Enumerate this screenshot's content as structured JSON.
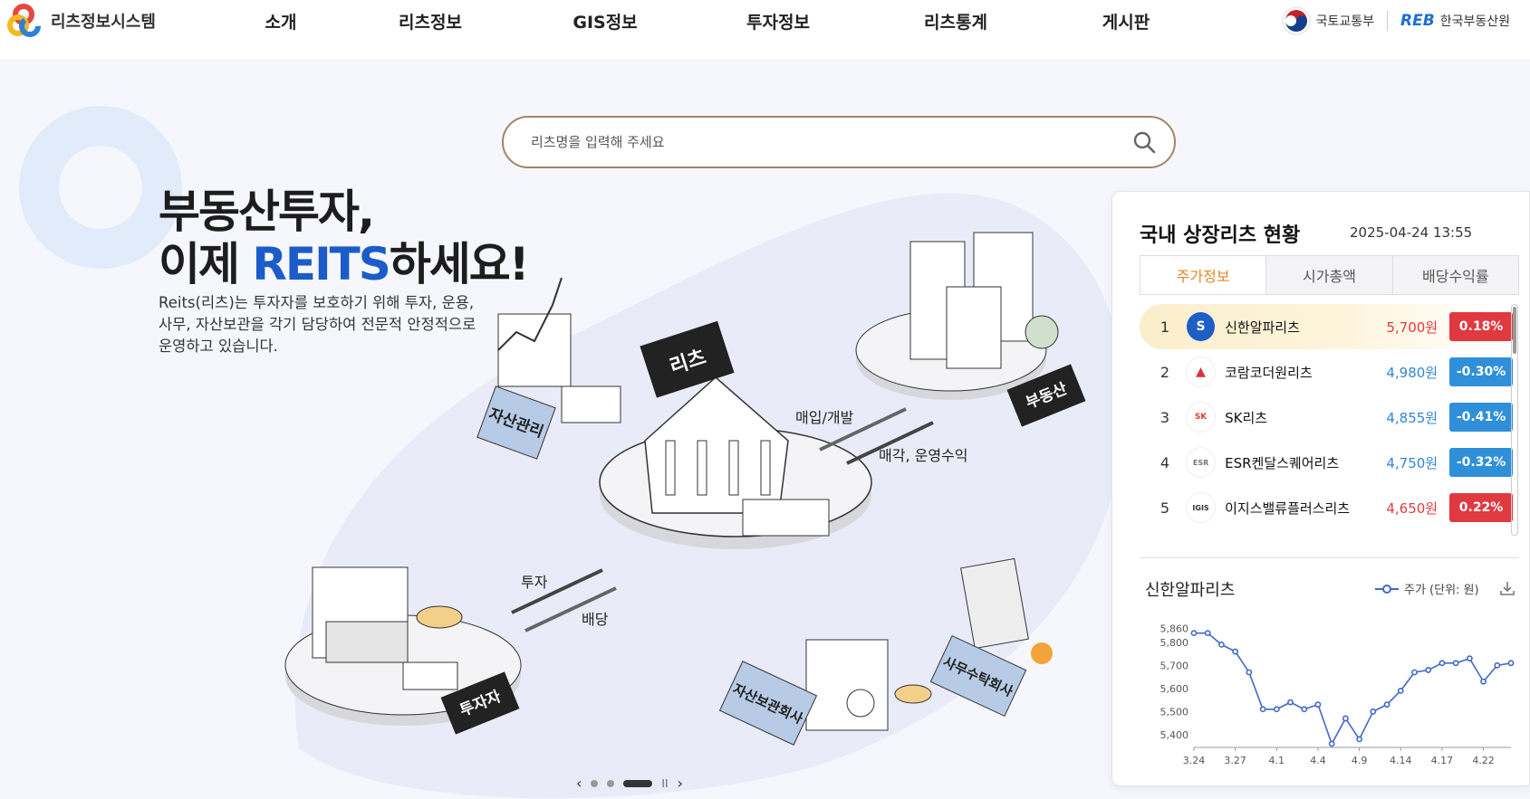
{
  "header": {
    "site_name": "리츠정보시스템",
    "nav": [
      "소개",
      "리츠정보",
      "GIS정보",
      "투자정보",
      "리츠통계",
      "게시판"
    ],
    "partner_molit": "국토교통부",
    "partner_reb_mark": "REB",
    "partner_reb": "한국부동산원"
  },
  "search": {
    "placeholder": "리츠명을 입력해 주세요"
  },
  "hero": {
    "title_line1": "부동산투자,",
    "title_line2_pre": "이제 ",
    "title_line2_accent": "REITS",
    "title_line2_post": "하세요!",
    "description": "Reits(리츠)는 투자자를 보호하기 위해 투자, 운용, 사무, 자산보관을 각기 담당하여 전문적 안정적으로 운영하고 있습니다."
  },
  "illustration": {
    "labels": {
      "center": "리츠",
      "asset_mgmt": "자산관리",
      "real_estate": "부동산",
      "investor": "투자자",
      "custodian": "자산보관회사",
      "admin": "사무수탁회사",
      "buy": "매입/개발",
      "sell": "매각, 운영수익",
      "invest": "투자",
      "dividend": "배당"
    }
  },
  "slider": {
    "prev": "‹",
    "next": "›",
    "pause": "II"
  },
  "panel": {
    "title": "국내 상장리츠 현황",
    "timestamp": "2025-04-24 13:55",
    "tabs": [
      "주가정보",
      "시가총액",
      "배당수익률"
    ],
    "rows": [
      {
        "rank": "1",
        "logo": "S",
        "name": "신한알파리츠",
        "price": "5,700원",
        "change": "0.18%",
        "dir": "up"
      },
      {
        "rank": "2",
        "logo": "▲",
        "name": "코람코더원리츠",
        "price": "4,980원",
        "change": "-0.30%",
        "dir": "down"
      },
      {
        "rank": "3",
        "logo": "SK",
        "name": "SK리츠",
        "price": "4,855원",
        "change": "-0.41%",
        "dir": "down"
      },
      {
        "rank": "4",
        "logo": "ESR",
        "name": "ESR켄달스퀘어리츠",
        "price": "4,750원",
        "change": "-0.32%",
        "dir": "down"
      },
      {
        "rank": "5",
        "logo": "IGIS",
        "name": "이지스밸류플러스리츠",
        "price": "4,650원",
        "change": "0.22%",
        "dir": "up"
      }
    ],
    "chart_title": "신한알파리츠",
    "legend": "주가 (단위: 원)"
  },
  "colors": {
    "accent_blue": "#1c5cc8",
    "up": "#e0393f",
    "down": "#2f8fd9",
    "tab_active": "#e0862a",
    "search_border": "#a08566"
  },
  "chart_data": {
    "type": "line",
    "series": [
      {
        "name": "주가 (단위: 원)",
        "values": [
          5840,
          5840,
          5790,
          5760,
          5670,
          5510,
          5510,
          5540,
          5510,
          5530,
          5360,
          5470,
          5380,
          5500,
          5530,
          5590,
          5670,
          5680,
          5710,
          5710,
          5730,
          5630,
          5700,
          5710
        ]
      }
    ],
    "x_ticks": [
      "3.24",
      "3.27",
      "4.1",
      "4.4",
      "4.9",
      "4.14",
      "4.17",
      "4.22"
    ],
    "x_tick_index": [
      0,
      3,
      6,
      9,
      12,
      15,
      18,
      21
    ],
    "y_ticks": [
      5860,
      5800,
      5700,
      5600,
      5500,
      5400
    ],
    "y_tick_labels": [
      "5,860",
      "5,800",
      "5,700",
      "5,600",
      "5,500",
      "5,400"
    ],
    "ylim": [
      5360,
      5870
    ],
    "color": "#4169c8"
  }
}
